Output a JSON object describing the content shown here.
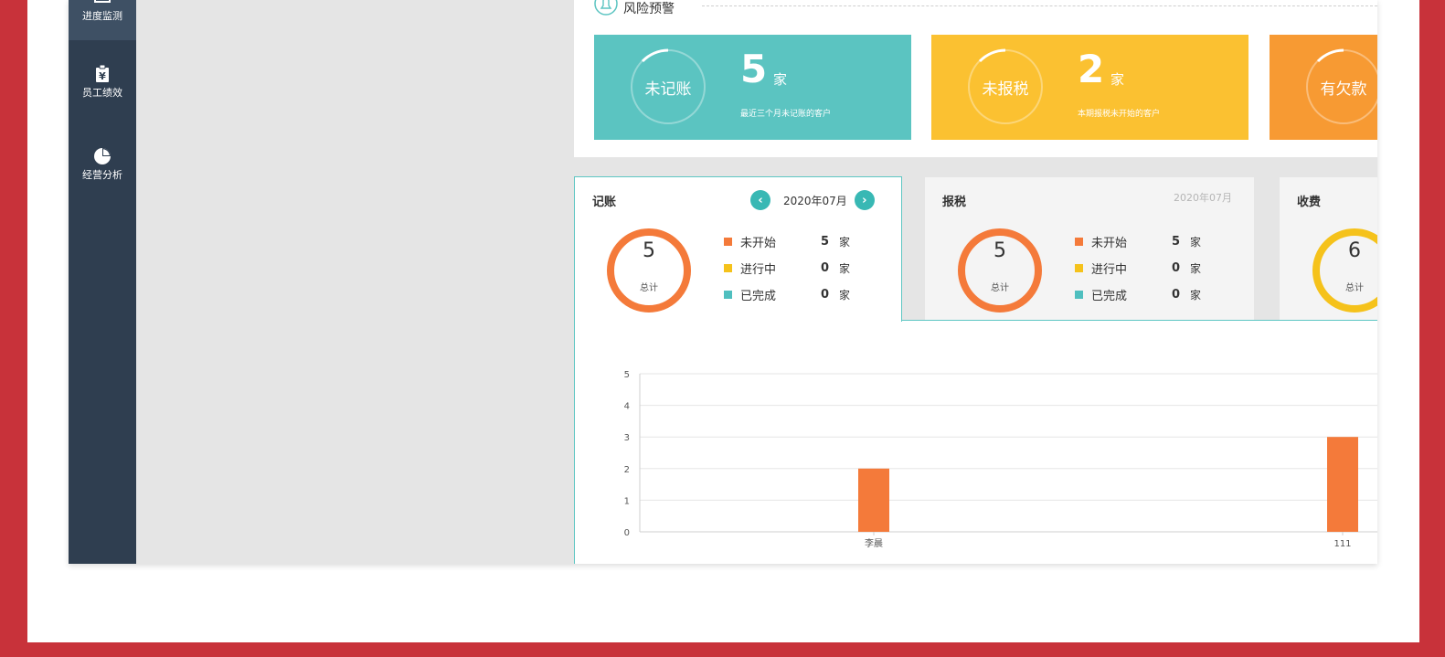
{
  "sidebar": {
    "items": [
      {
        "label": "进度监测",
        "icon": "calendar-icon",
        "active": true
      },
      {
        "label": "员工绩效",
        "icon": "clipboard-yen-icon",
        "active": false
      },
      {
        "label": "经营分析",
        "icon": "pie-chart-icon",
        "active": false
      }
    ]
  },
  "risk": {
    "title": "风险预警",
    "cards": [
      {
        "ring_label": "未记账",
        "count": "5",
        "unit": "家",
        "desc": "最近三个月未记账的客户",
        "color": "#5bc4c1"
      },
      {
        "ring_label": "未报税",
        "count": "2",
        "unit": "家",
        "desc": "本期报税未开始的客户",
        "color": "#fbc131"
      },
      {
        "ring_label": "有欠款",
        "count": "",
        "unit": "",
        "desc": "",
        "color": "#f79a33"
      }
    ]
  },
  "stats": [
    {
      "title": "记账",
      "date": "2020年07月",
      "total": "5",
      "total_label": "总计",
      "ring_color": "#f47a3a",
      "legend": [
        {
          "name": "未开始",
          "value": "5",
          "unit": "家",
          "color": "#f47a3a"
        },
        {
          "name": "进行中",
          "value": "0",
          "unit": "家",
          "color": "#f5c21b"
        },
        {
          "name": "已完成",
          "value": "0",
          "unit": "家",
          "color": "#4fbfbf"
        }
      ]
    },
    {
      "title": "报税",
      "date": "2020年07月",
      "total": "5",
      "total_label": "总计",
      "ring_color": "#f47a3a",
      "legend": [
        {
          "name": "未开始",
          "value": "5",
          "unit": "家",
          "color": "#f47a3a"
        },
        {
          "name": "进行中",
          "value": "0",
          "unit": "家",
          "color": "#f5c21b"
        },
        {
          "name": "已完成",
          "value": "0",
          "unit": "家",
          "color": "#4fbfbf"
        }
      ]
    },
    {
      "title": "收费",
      "date": "",
      "total": "6",
      "total_label": "总计",
      "ring_color": "#f5c21b",
      "legend": []
    }
  ],
  "chart_data": {
    "type": "bar",
    "categories": [
      "李晨",
      "111"
    ],
    "values": [
      2,
      3
    ],
    "ylim": [
      0,
      5
    ],
    "yticks": [
      "0",
      "1",
      "2",
      "3",
      "4",
      "5"
    ],
    "grid": true,
    "bar_color": "#f47a3a"
  }
}
